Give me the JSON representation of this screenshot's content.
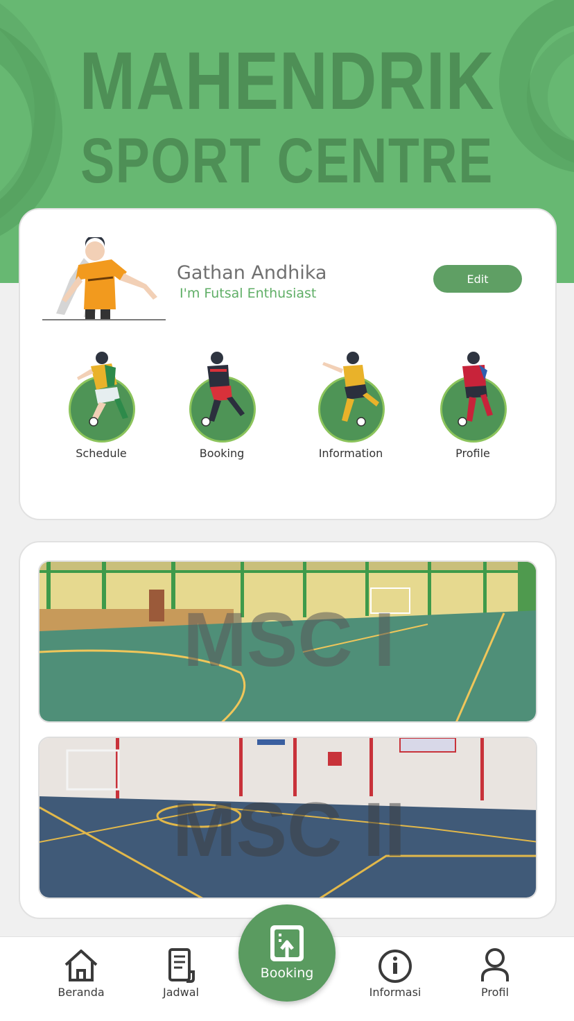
{
  "header": {
    "brand_line1": "MAHENDRIK",
    "brand_line2": "SPORT CENTRE"
  },
  "profile": {
    "name": "Gathan Andhika",
    "tagline": "I'm Futsal Enthusiast",
    "edit_label": "Edit"
  },
  "menu": [
    {
      "label": "Schedule",
      "icon": "player-icon"
    },
    {
      "label": "Booking",
      "icon": "player-icon"
    },
    {
      "label": "Information",
      "icon": "player-icon"
    },
    {
      "label": "Profile",
      "icon": "player-icon"
    }
  ],
  "gallery": [
    {
      "watermark": "MSC I"
    },
    {
      "watermark": "MSC II"
    }
  ],
  "nav": {
    "home": "Beranda",
    "schedule": "Jadwal",
    "booking": "Booking",
    "info": "Informasi",
    "profile": "Profil"
  },
  "colors": {
    "header_green": "#67b872",
    "accent_green": "#5a9b60",
    "tagline_green": "#5fae66"
  }
}
